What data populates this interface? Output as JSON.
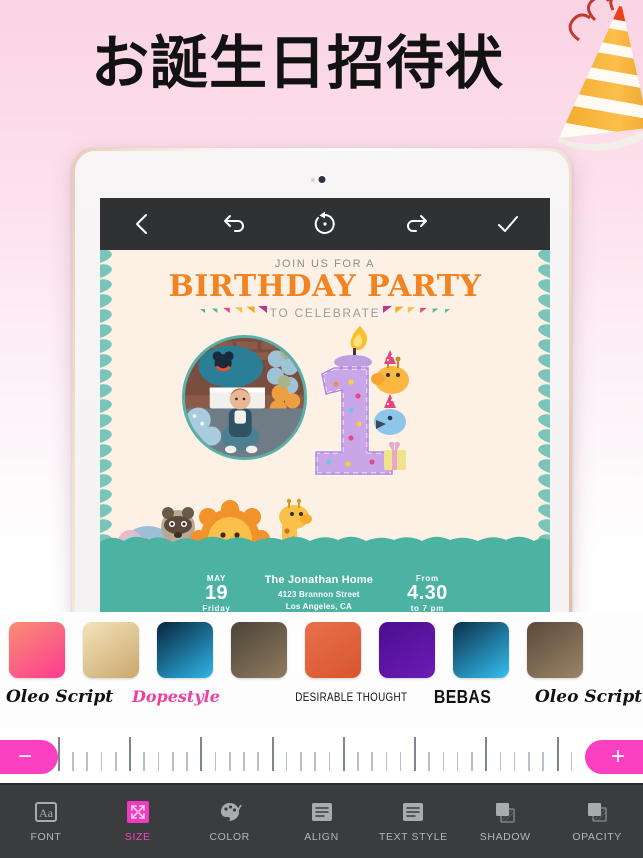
{
  "hero": {
    "title": "お誕生日招待状",
    "party_hat_icon": "party-hat-icon",
    "background_top_color": "#fad3e4",
    "background_bottom_color": "#ffffff"
  },
  "device": {
    "frame": "tablet-rose-gold",
    "camera_icon": "front-camera-icon"
  },
  "editor_toolbar": {
    "back_icon": "chevron-left-icon",
    "undo_icon": "undo-arrow-icon",
    "reset_icon": "reset-circular-arrow-icon",
    "redo_icon": "redo-arrow-icon",
    "confirm_icon": "checkmark-icon"
  },
  "invitation": {
    "join_us": "JOIN US FOR A",
    "title": "BIRTHDAY PARTY",
    "to_celebrate": "TO CELEBRATE",
    "title_color": "#f28322",
    "card_background": "#fdf1e6",
    "leaf_color": "#79c5bb",
    "grass_color": "#4cb2a2",
    "photo_alt": "birthday-baby-photo",
    "candle_number": "1",
    "bunting_colors": [
      "#c0338c",
      "#f5a623",
      "#f2c14e",
      "#e8467c",
      "#57b894",
      "#4db6ac"
    ],
    "animals": [
      "elephant",
      "raccoon",
      "lion",
      "giraffe",
      "bluebird"
    ],
    "footer": {
      "month": "MAY",
      "day": "19",
      "weekday": "Friday",
      "venue": "The Jonathan Home",
      "address_line1": "4123 Brannon Street",
      "address_line2": "Los Angeles, CA",
      "from_label": "From",
      "from_time": "4.30",
      "to_time": "to 7 pm"
    }
  },
  "font_strip": [
    {
      "name": "Oleo Script",
      "style": "oleo",
      "thumb_from": "#f98f72",
      "thumb_to": "#fc3a93"
    },
    {
      "name": "Dopestyle",
      "style": "dope",
      "thumb_from": "#f3e3bd",
      "thumb_to": "#c9a86a"
    },
    {
      "name": "DESIRABLE THOUGHT",
      "style": "desir",
      "thumb_from": "#07253f",
      "thumb_to": "#2fb6e8"
    },
    {
      "name": "BEBAS",
      "style": "bebas",
      "thumb_from": "#4a4438",
      "thumb_to": "#8f7a5e"
    },
    {
      "name": "Oleo Script",
      "style": "oleo",
      "thumb_from": "#e8714a",
      "thumb_to": "#d8552f"
    },
    {
      "name": "Dopestyle",
      "style": "dope",
      "thumb_from": "#4a0f8f",
      "thumb_to": "#6d1bb5"
    },
    {
      "name": "DESIRABLE THOUGHT",
      "style": "desir",
      "thumb_from": "#0a2f4c",
      "thumb_to": "#35c0ef"
    },
    {
      "name": "BEBAS",
      "style": "bebas",
      "thumb_from": "#5a4a3a",
      "thumb_to": "#9b8468"
    }
  ],
  "font_labels": [
    "Oleo Script",
    "Dopestyle",
    "DESIRABLE THOUGHT",
    "BEBAS",
    "Oleo Script"
  ],
  "size_slider": {
    "decrease_label": "−",
    "increase_label": "+",
    "accent_color": "#fa3fc0",
    "tick_count": 38,
    "major_every": 5
  },
  "bottom_toolbar": {
    "active": "SIZE",
    "active_color": "#ef46c0",
    "items": [
      {
        "label": "FONT",
        "icon": "font-aa-icon"
      },
      {
        "label": "SIZE",
        "icon": "resize-arrows-icon"
      },
      {
        "label": "COLOR",
        "icon": "color-palette-icon"
      },
      {
        "label": "ALIGN",
        "icon": "align-lines-icon"
      },
      {
        "label": "TEXT STYLE",
        "icon": "text-style-lines-icon"
      },
      {
        "label": "SHADOW",
        "icon": "shadow-squares-icon"
      },
      {
        "label": "OPACITY",
        "icon": "opacity-squares-icon"
      }
    ]
  }
}
